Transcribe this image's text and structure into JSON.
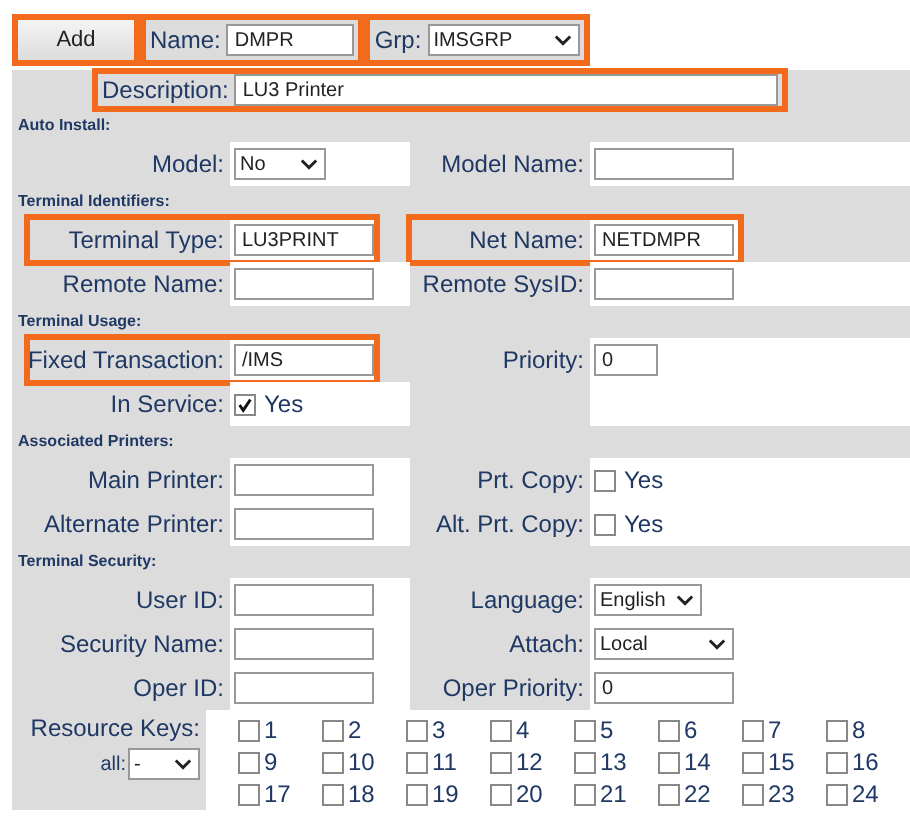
{
  "header": {
    "button": {
      "label": "Add",
      "highlighted": true
    },
    "fields": [
      {
        "kind": "text",
        "label": "Name:",
        "value": "DMPR",
        "highlighted": true
      },
      {
        "kind": "select",
        "label": "Grp:",
        "value": "IMSGRP",
        "highlighted": true
      }
    ]
  },
  "description": {
    "label": "Description:",
    "value": "LU3 Printer",
    "highlighted": true
  },
  "sections": [
    {
      "title": "Auto Install:",
      "rows": [
        [
          {
            "kind": "select",
            "label": "Model:",
            "value": "No",
            "highlighted": false
          },
          {
            "kind": "text",
            "label": "Model Name:",
            "highlighted": false
          }
        ]
      ]
    },
    {
      "title": "Terminal Identifiers:",
      "rows": [
        [
          {
            "kind": "text",
            "label": "Terminal Type:",
            "value": "LU3PRINT",
            "highlighted": true
          },
          {
            "kind": "text",
            "label": "Net Name:",
            "value": "NETDMPR",
            "highlighted": true
          }
        ],
        [
          {
            "kind": "text",
            "label": "Remote Name:",
            "highlighted": false
          },
          {
            "kind": "text",
            "label": "Remote SysID:",
            "highlighted": false
          }
        ]
      ]
    },
    {
      "title": "Terminal Usage:",
      "rows": [
        [
          {
            "kind": "text",
            "label": "Fixed Transaction:",
            "value": "/IMS",
            "highlighted": true
          },
          {
            "kind": "short",
            "label": "Priority:",
            "value": "0",
            "highlighted": false
          }
        ],
        [
          {
            "kind": "checkbox",
            "label": "In Service:",
            "option": "Yes",
            "checked": true,
            "highlighted": false
          },
          {
            "kind": "empty"
          }
        ]
      ]
    },
    {
      "title": "Associated Printers:",
      "rows": [
        [
          {
            "kind": "text",
            "label": "Main Printer:",
            "highlighted": false
          },
          {
            "kind": "checkbox",
            "label": "Prt. Copy:",
            "option": "Yes",
            "checked": false,
            "highlighted": false
          }
        ],
        [
          {
            "kind": "text",
            "label": "Alternate Printer:",
            "highlighted": false
          },
          {
            "kind": "checkbox",
            "label": "Alt. Prt. Copy:",
            "option": "Yes",
            "checked": false,
            "highlighted": false
          }
        ]
      ]
    },
    {
      "title": "Terminal Security:",
      "rows": [
        [
          {
            "kind": "text",
            "label": "User ID:",
            "highlighted": false
          },
          {
            "kind": "short_select",
            "label": "Language:",
            "value": "English",
            "highlighted": false
          }
        ],
        [
          {
            "kind": "text",
            "label": "Security Name:",
            "highlighted": false
          },
          {
            "kind": "select",
            "label": "Attach:",
            "value": "Local",
            "highlighted": false
          }
        ],
        [
          {
            "kind": "text",
            "label": "Oper ID:",
            "highlighted": false
          },
          {
            "kind": "text",
            "label": "Oper Priority:",
            "value": "0",
            "highlighted": false
          }
        ]
      ]
    }
  ],
  "resource_keys": {
    "label": "Resource Keys:",
    "all_label": "all:",
    "all_value": "-",
    "keys": [
      {
        "label": "1",
        "checked": false
      },
      {
        "label": "2",
        "checked": false
      },
      {
        "label": "3",
        "checked": false
      },
      {
        "label": "4",
        "checked": false
      },
      {
        "label": "5",
        "checked": false
      },
      {
        "label": "6",
        "checked": false
      },
      {
        "label": "7",
        "checked": false
      },
      {
        "label": "8",
        "checked": false
      },
      {
        "label": "9",
        "checked": false
      },
      {
        "label": "10",
        "checked": false
      },
      {
        "label": "11",
        "checked": false
      },
      {
        "label": "12",
        "checked": false
      },
      {
        "label": "13",
        "checked": false
      },
      {
        "label": "14",
        "checked": false
      },
      {
        "label": "15",
        "checked": false
      },
      {
        "label": "16",
        "checked": false
      },
      {
        "label": "17",
        "checked": false
      },
      {
        "label": "18",
        "checked": false
      },
      {
        "label": "19",
        "checked": false
      },
      {
        "label": "20",
        "checked": false
      },
      {
        "label": "21",
        "checked": false
      },
      {
        "label": "22",
        "checked": false
      },
      {
        "label": "23",
        "checked": false
      },
      {
        "label": "24",
        "checked": false
      }
    ]
  }
}
